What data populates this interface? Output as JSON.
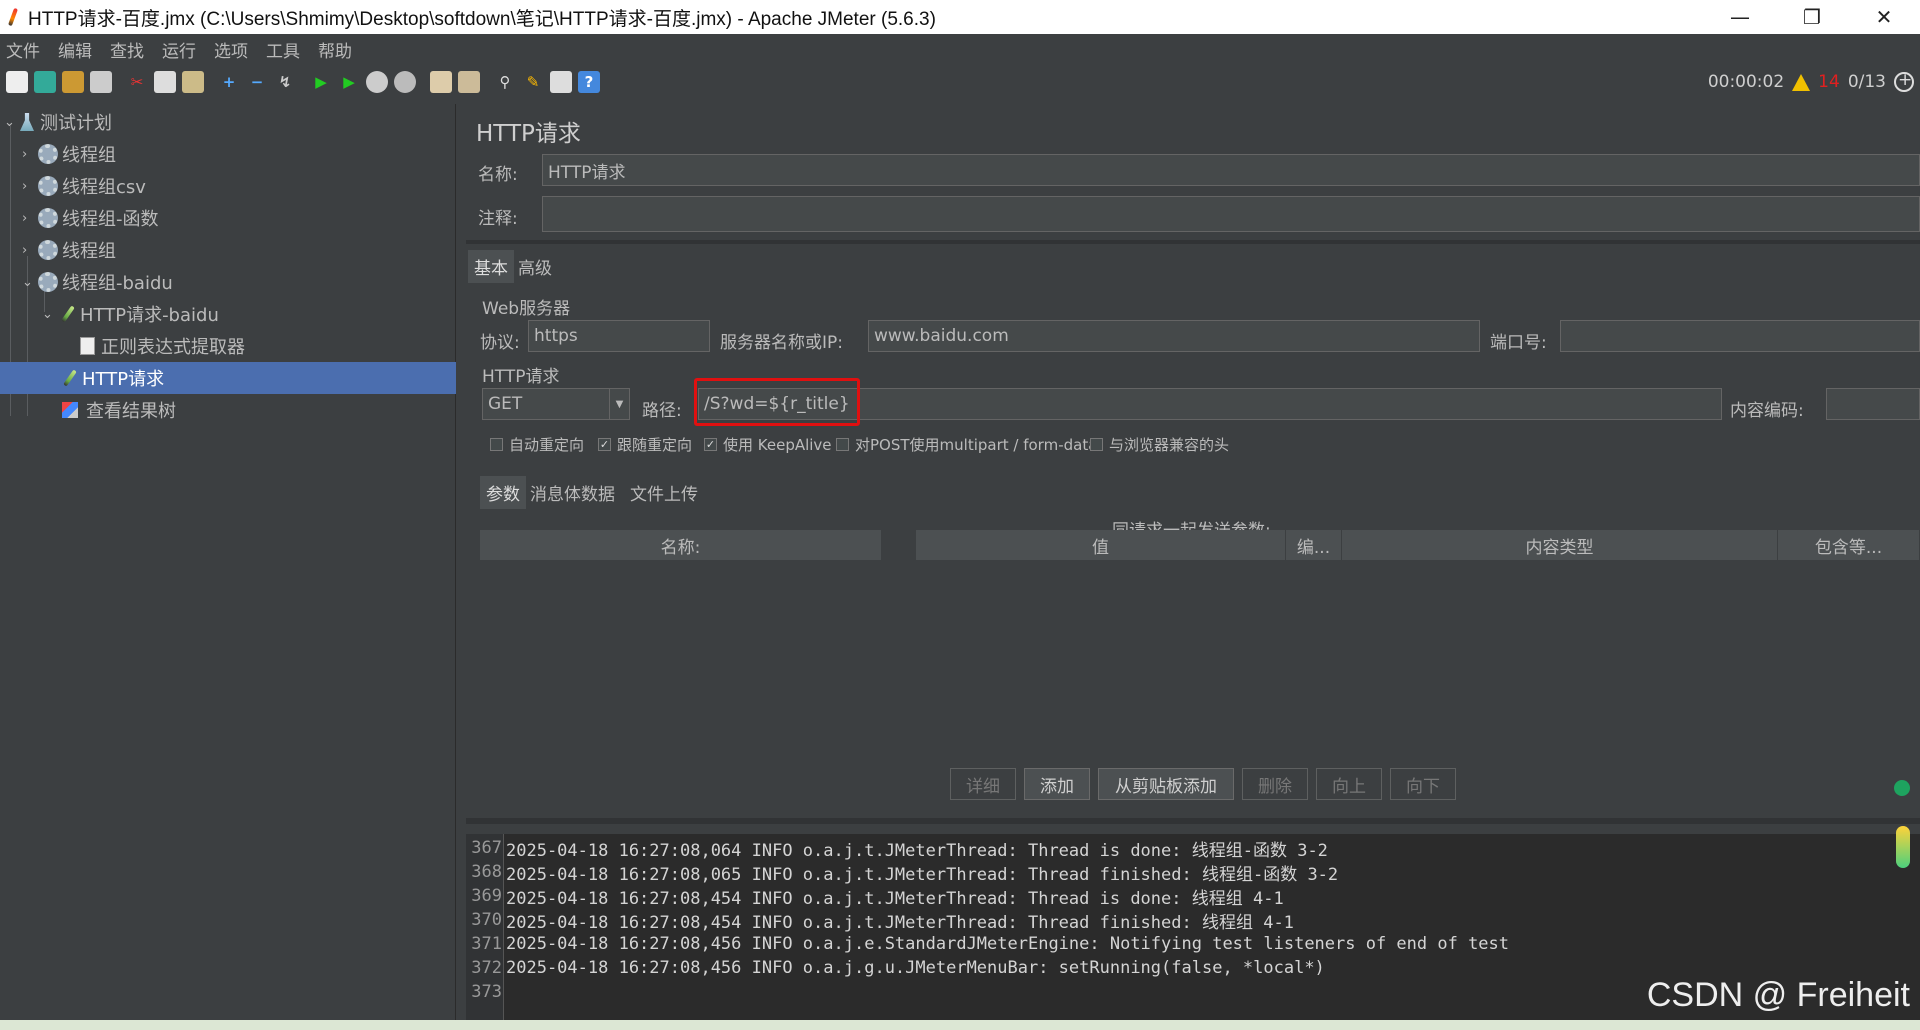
{
  "window": {
    "title": "HTTP请求-百度.jmx (C:\\Users\\Shmimy\\Desktop\\softdown\\笔记\\HTTP请求-百度.jmx) - Apache JMeter (5.6.3)",
    "minimize": "—",
    "maximize": "❐",
    "close": "✕"
  },
  "menu": [
    "文件",
    "编辑",
    "查找",
    "运行",
    "选项",
    "工具",
    "帮助"
  ],
  "toolbar": {
    "elapsed": "00:00:02",
    "warnings": "14",
    "threads": "0/13"
  },
  "tree": {
    "root": "测试计划",
    "items": [
      "线程组",
      "线程组csv",
      "线程组-函数",
      "线程组",
      "线程组-baidu",
      "HTTP请求-baidu",
      "正则表达式提取器",
      "HTTP请求",
      "查看结果树"
    ]
  },
  "panel": {
    "title": "HTTP请求",
    "name_label": "名称:",
    "name_value": "HTTP请求",
    "comment_label": "注释:",
    "comment_value": "",
    "tabs": [
      "基本",
      "高级"
    ],
    "web_server_section": "Web服务器",
    "protocol_label": "协议:",
    "protocol_value": "https",
    "server_label": "服务器名称或IP:",
    "server_value": "www.baidu.com",
    "port_label": "端口号:",
    "port_value": "",
    "http_section": "HTTP请求",
    "method": "GET",
    "path_label": "路径:",
    "path_value": "/S?wd=${r_title}",
    "encoding_label": "内容编码:",
    "encoding_value": "",
    "checkboxes": [
      {
        "label": "自动重定向",
        "checked": false
      },
      {
        "label": "跟随重定向",
        "checked": true
      },
      {
        "label": "使用 KeepAlive",
        "checked": true
      },
      {
        "label": "对POST使用multipart / form-data",
        "checked": false
      },
      {
        "label": "与浏览器兼容的头",
        "checked": false
      }
    ],
    "sub_tabs": [
      "参数",
      "消息体数据",
      "文件上传"
    ],
    "params_caption": "同请求一起发送参数:",
    "table_headers": [
      "名称:",
      "值",
      "编...",
      "内容类型",
      "包含等..."
    ],
    "buttons": [
      "详细",
      "添加",
      "从剪贴板添加",
      "删除",
      "向上",
      "向下"
    ]
  },
  "log": {
    "lines": [
      {
        "n": "367",
        "text": "2025-04-18 16:27:08,064 INFO o.a.j.t.JMeterThread: Thread is done: 线程组-函数 3-2"
      },
      {
        "n": "368",
        "text": "2025-04-18 16:27:08,065 INFO o.a.j.t.JMeterThread: Thread finished: 线程组-函数 3-2"
      },
      {
        "n": "369",
        "text": "2025-04-18 16:27:08,454 INFO o.a.j.t.JMeterThread: Thread is done: 线程组 4-1"
      },
      {
        "n": "370",
        "text": "2025-04-18 16:27:08,454 INFO o.a.j.t.JMeterThread: Thread finished: 线程组 4-1"
      },
      {
        "n": "371",
        "text": "2025-04-18 16:27:08,456 INFO o.a.j.e.StandardJMeterEngine: Notifying test listeners of end of test"
      },
      {
        "n": "372",
        "text": "2025-04-18 16:27:08,456 INFO o.a.j.g.u.JMeterMenuBar: setRunning(false, *local*)"
      },
      {
        "n": "373",
        "text": ""
      }
    ]
  },
  "watermark": "CSDN @ Freiheit"
}
